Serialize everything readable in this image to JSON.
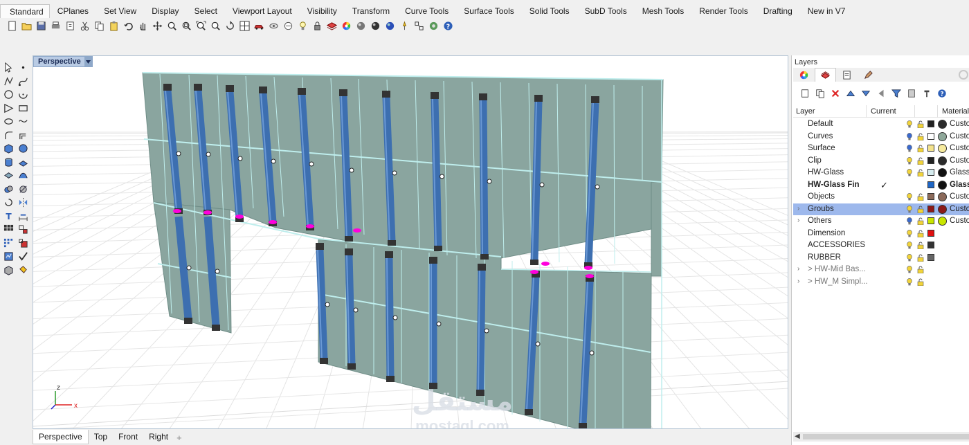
{
  "menu_tabs": [
    "Standard",
    "CPlanes",
    "Set View",
    "Display",
    "Select",
    "Viewport Layout",
    "Visibility",
    "Transform",
    "Curve Tools",
    "Surface Tools",
    "Solid Tools",
    "SubD Tools",
    "Mesh Tools",
    "Render Tools",
    "Drafting",
    "New in V7"
  ],
  "toolbar_icons": [
    "new-icon",
    "open-icon",
    "save-icon",
    "print-icon",
    "import-icon",
    "cut-icon",
    "copy-icon",
    "paste-icon",
    "undo-icon",
    "pan-icon",
    "move-icon",
    "zoom-icon",
    "zoom-window-icon",
    "zoom-extents-icon",
    "zoom-selected-icon",
    "rotate-view-icon",
    "four-view-icon",
    "car-icon",
    "hide-icon",
    "show-icon",
    "bulb-icon",
    "lock-icon",
    "layer-icon",
    "color-wheel-icon",
    "render-sphere-icon",
    "shaded-sphere-icon",
    "globe-icon",
    "light-icon",
    "grid-snap-icon",
    "options-icon",
    "help-icon"
  ],
  "left_tools": [
    "select-arrow-icon",
    "point-icon",
    "polyline-icon",
    "curve-icon",
    "circle-icon",
    "arc-icon",
    "polygon-icon",
    "rectangle-icon",
    "ellipse-icon",
    "freeform-icon",
    "fillet-curve-icon",
    "offset-icon",
    "box-icon",
    "sphere-icon",
    "cylinder-icon",
    "extrude-icon",
    "plane-icon",
    "loft-icon",
    "boolean-icon",
    "split-icon",
    "rotate-icon",
    "mirror-icon",
    "text-icon",
    "dimension-icon",
    "array-icon",
    "group-icon",
    "grid-array-icon",
    "scale-icon",
    "analyze-icon",
    "check-icon",
    "block-icon",
    "paint-icon"
  ],
  "viewport": {
    "title": "Perspective",
    "axis_labels": {
      "z": "z",
      "x": "x"
    }
  },
  "viewport_tabs": [
    "Perspective",
    "Top",
    "Front",
    "Right"
  ],
  "watermark": {
    "arabic": "مستقل",
    "latin": "mostaql.com"
  },
  "layers_panel": {
    "title": "Layers",
    "tab_icons": [
      "color-wheel-icon",
      "layers-icon",
      "document-icon",
      "pen-icon"
    ],
    "tool_icons": [
      "new-layer-icon",
      "new-sublayer-icon",
      "delete-icon",
      "move-up-icon",
      "move-down-icon",
      "move-left-icon",
      "filter-icon",
      "layer-tools-icon",
      "hammer-icon",
      "help-icon"
    ],
    "headers": {
      "layer": "Layer",
      "current": "Current",
      "material": "Material"
    },
    "rows": [
      {
        "name": "Default",
        "color": "#222222",
        "material_color": "#2b2b2b",
        "material": "Custo"
      },
      {
        "name": "Curves",
        "color": "#ffffff",
        "material_color": "#8fa89a",
        "material": "Custo",
        "bulb": "blue"
      },
      {
        "name": "Surface",
        "color": "#f4e38c",
        "material_color": "#f6ea9d",
        "material": "Custo",
        "bulb": "blue"
      },
      {
        "name": "Clip",
        "color": "#222222",
        "material_color": "#2b2b2b",
        "material": "Custo"
      },
      {
        "name": "HW-Glass",
        "color": "#d6ecef",
        "material_color": "#111111",
        "material": "Glass"
      },
      {
        "name": "HW-Glass Fin",
        "color": "#1f66c4",
        "material_color": "#111111",
        "material": "Glass",
        "bold": true,
        "current": "✓",
        "hidden_icons": true
      },
      {
        "name": "Objects",
        "color": "#8b6a5a",
        "material_color": "#8b6a5a",
        "material": "Custo"
      },
      {
        "name": "Groubs",
        "color": "#8b1a1a",
        "material_color": "#8b1a1a",
        "material": "Custo",
        "selected": true,
        "expand": "›"
      },
      {
        "name": "Others",
        "color": "#c9e600",
        "material_color": "#c9e600",
        "material": "Custo",
        "expand": "›",
        "bulb": "blue"
      },
      {
        "name": "Dimension",
        "color": "#e01010",
        "material_color": "",
        "material": ""
      },
      {
        "name": "ACCESSORIES",
        "color": "#333333",
        "material_color": "",
        "material": ""
      },
      {
        "name": "RUBBER",
        "color": "#666666",
        "material_color": "",
        "material": ""
      },
      {
        "name": "> HW-Mid Bas...",
        "color": "",
        "material_color": "",
        "material": "",
        "expand": "›",
        "dim": true
      },
      {
        "name": "> HW_M Simpl...",
        "color": "",
        "material_color": "",
        "material": "",
        "expand": "›",
        "dim": true
      }
    ]
  },
  "colors": {
    "glass": "#8aa59f",
    "fin": "#3d6fb0",
    "accent_selection": "#9db8ec",
    "viewport_title": "#b9cbe4",
    "magenta_gasket": "#ff00dd"
  }
}
